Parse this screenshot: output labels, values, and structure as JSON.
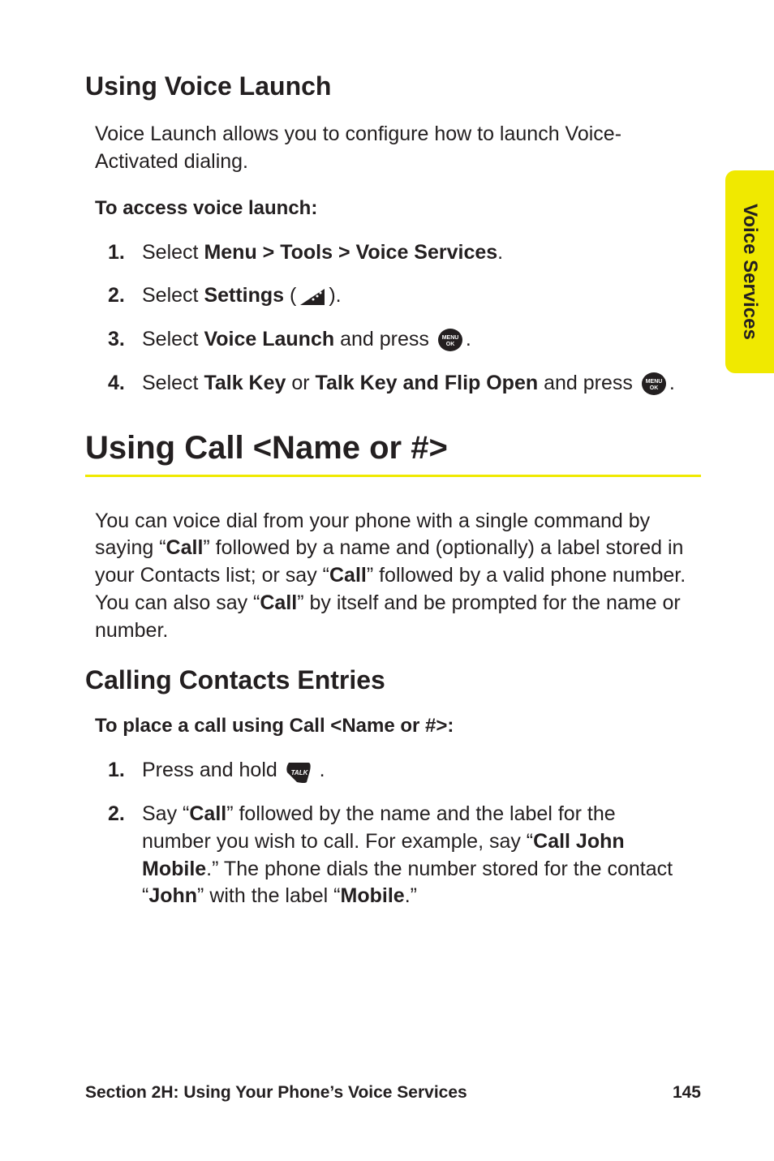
{
  "sideTab": "Voice Services",
  "section1": {
    "heading": "Using Voice Launch",
    "intro": "Voice Launch allows you to configure how to launch Voice-Activated dialing.",
    "subLabel": "To access voice launch:",
    "steps": {
      "s1_pre": "Select ",
      "s1_b": "Menu > Tools > Voice Services",
      "s1_post": ".",
      "s2_pre": "Select ",
      "s2_b": "Settings",
      "s2_post1": " (",
      "s2_post2": ").",
      "s3_pre": "Select ",
      "s3_b": "Voice Launch",
      "s3_mid": " and press ",
      "s3_post": ".",
      "s4_pre": "Select ",
      "s4_b1": "Talk Key",
      "s4_mid1": " or ",
      "s4_b2": "Talk Key and Flip Open",
      "s4_mid2": " and press ",
      "s4_post": "."
    }
  },
  "section2": {
    "heading": "Using Call <Name or #>",
    "intro_p1": "You can voice dial from your phone with a single command by saying “",
    "intro_b1": "Call",
    "intro_p2": "” followed by a name and (optionally) a label stored in your Contacts list; or say “",
    "intro_b2": "Call",
    "intro_p3": "” followed by a valid phone number. You can also say “",
    "intro_b3": "Call",
    "intro_p4": "” by itself and be prompted for the name or number."
  },
  "section3": {
    "heading": "Calling Contacts Entries",
    "subLabel": "To place a call using Call <Name or #>:",
    "steps": {
      "s1_pre": "Press and hold ",
      "s1_post": " .",
      "s2_p1": "Say “",
      "s2_b1": "Call",
      "s2_p2": "” followed by the name and the label for the number you wish to call. For example, say “",
      "s2_b2": "Call John Mobile",
      "s2_p3": ".” The phone dials the number stored for the contact “",
      "s2_b3": "John",
      "s2_p4": "” with the label “",
      "s2_b4": "Mobile",
      "s2_p5": ".”"
    }
  },
  "footer": {
    "section": "Section 2H: Using Your Phone’s Voice Services",
    "page": "145"
  },
  "nums": {
    "n1": "1.",
    "n2": "2.",
    "n3": "3.",
    "n4": "4."
  }
}
